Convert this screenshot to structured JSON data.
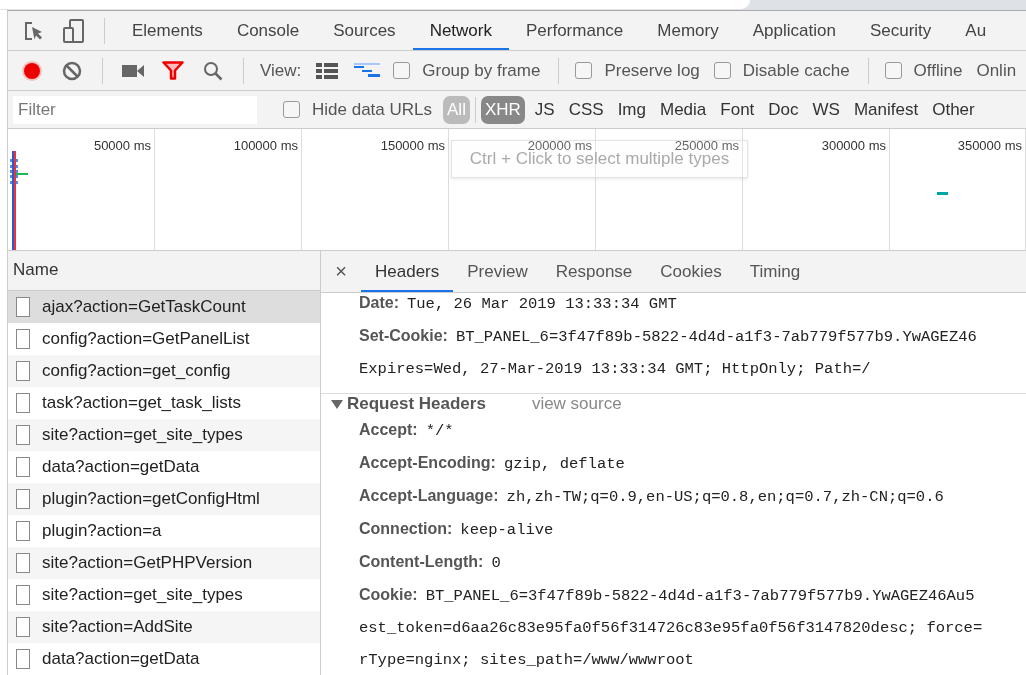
{
  "devtools_tabs": [
    {
      "label": "Elements",
      "selected": false
    },
    {
      "label": "Console",
      "selected": false
    },
    {
      "label": "Sources",
      "selected": false
    },
    {
      "label": "Network",
      "selected": true
    },
    {
      "label": "Performance",
      "selected": false
    },
    {
      "label": "Memory",
      "selected": false
    },
    {
      "label": "Application",
      "selected": false
    },
    {
      "label": "Security",
      "selected": false
    },
    {
      "label": "Au",
      "selected": false
    }
  ],
  "toolbar": {
    "recording": true,
    "view_label": "View:",
    "large_rows": false,
    "waterfall": true,
    "options": [
      {
        "label": "Group by frame",
        "checked": false
      },
      {
        "label": "Preserve log",
        "checked": false
      },
      {
        "label": "Disable cache",
        "checked": false
      },
      {
        "label": "Offline",
        "checked": false
      }
    ],
    "throttling": "Onlin"
  },
  "filter_bar": {
    "placeholder": "Filter",
    "hide_data_urls": {
      "label": "Hide data URLs",
      "checked": false
    },
    "types": [
      {
        "label": "All",
        "selected": false,
        "hovered": true
      },
      {
        "label": "XHR",
        "selected": true,
        "hovered": false
      },
      {
        "label": "JS",
        "selected": false,
        "hovered": false
      },
      {
        "label": "CSS",
        "selected": false,
        "hovered": false
      },
      {
        "label": "Img",
        "selected": false,
        "hovered": false
      },
      {
        "label": "Media",
        "selected": false,
        "hovered": false
      },
      {
        "label": "Font",
        "selected": false,
        "hovered": false
      },
      {
        "label": "Doc",
        "selected": false,
        "hovered": false
      },
      {
        "label": "WS",
        "selected": false,
        "hovered": false
      },
      {
        "label": "Manifest",
        "selected": false,
        "hovered": false
      },
      {
        "label": "Other",
        "selected": false,
        "hovered": false
      }
    ]
  },
  "overview": {
    "ticks": [
      "50000 ms",
      "100000 ms",
      "150000 ms",
      "200000 ms",
      "250000 ms",
      "300000 ms",
      "350000 ms"
    ],
    "tooltip": "Ctrl + Click to select multiple types"
  },
  "requests": {
    "column": "Name",
    "rows": [
      {
        "name": "ajax?action=GetTaskCount",
        "selected": true
      },
      {
        "name": "config?action=GetPanelList",
        "selected": false
      },
      {
        "name": "config?action=get_config",
        "selected": false
      },
      {
        "name": "task?action=get_task_lists",
        "selected": false
      },
      {
        "name": "site?action=get_site_types",
        "selected": false
      },
      {
        "name": "data?action=getData",
        "selected": false
      },
      {
        "name": "plugin?action=getConfigHtml",
        "selected": false
      },
      {
        "name": "plugin?action=a",
        "selected": false
      },
      {
        "name": "site?action=GetPHPVersion",
        "selected": false
      },
      {
        "name": "site?action=get_site_types",
        "selected": false
      },
      {
        "name": "site?action=AddSite",
        "selected": false
      },
      {
        "name": "data?action=getData",
        "selected": false
      }
    ]
  },
  "details": {
    "close": "×",
    "tabs": [
      {
        "label": "Headers",
        "selected": true
      },
      {
        "label": "Preview",
        "selected": false
      },
      {
        "label": "Response",
        "selected": false
      },
      {
        "label": "Cookies",
        "selected": false
      },
      {
        "label": "Timing",
        "selected": false
      }
    ],
    "response_headers": [
      {
        "name": "Date:",
        "value_lines": [
          "Tue, 26 Mar 2019 13:33:34 GMT"
        ]
      },
      {
        "name": "Set-Cookie:",
        "value_lines": [
          "BT_PANEL_6=3f47f89b-5822-4d4d-a1f3-7ab779f577b9.YwAGEZ46",
          "Expires=Wed, 27-Mar-2019 13:33:34 GMT; HttpOnly; Path=/"
        ]
      }
    ],
    "request_section": {
      "title": "Request Headers",
      "expanded": true,
      "link": "view source"
    },
    "request_headers": [
      {
        "name": "Accept:",
        "value_lines": [
          "*/*"
        ]
      },
      {
        "name": "Accept-Encoding:",
        "value_lines": [
          "gzip, deflate"
        ]
      },
      {
        "name": "Accept-Language:",
        "value_lines": [
          "zh,zh-TW;q=0.9,en-US;q=0.8,en;q=0.7,zh-CN;q=0.6"
        ]
      },
      {
        "name": "Connection:",
        "value_lines": [
          "keep-alive"
        ]
      },
      {
        "name": "Content-Length:",
        "value_lines": [
          "0"
        ]
      },
      {
        "name": "Cookie:",
        "value_lines": [
          "BT_PANEL_6=3f47f89b-5822-4d4d-a1f3-7ab779f577b9.YwAGEZ46Au5",
          "est_token=d6aa26c83e95fa0f56f314726c83e95fa0f56f3147820desc; force=",
          "rType=nginx; sites_path=/www/wwwroot"
        ]
      }
    ]
  }
}
